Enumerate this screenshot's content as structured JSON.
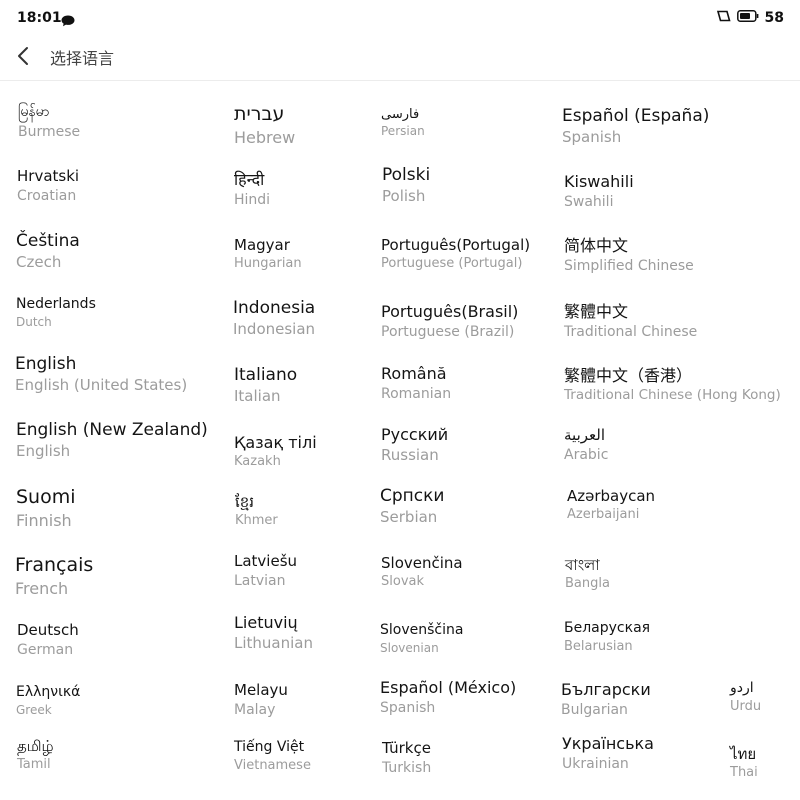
{
  "status_bar": {
    "time": "18:01",
    "battery_level": "58",
    "icons": [
      "chat-bubble-icon",
      "screen-rotation-icon",
      "battery-icon"
    ]
  },
  "header": {
    "title": "选择语言",
    "back_icon": "chevron-left-icon"
  },
  "languages": [
    {
      "native": "မြန်မာ",
      "english": "Burmese"
    },
    {
      "native": "Hrvatski",
      "english": "Croatian"
    },
    {
      "native": "Čeština",
      "english": "Czech"
    },
    {
      "native": "Nederlands",
      "english": "Dutch"
    },
    {
      "native": "English",
      "english": "English (United States)"
    },
    {
      "native": "English (New Zealand)",
      "english": "English"
    },
    {
      "native": "Suomi",
      "english": "Finnish"
    },
    {
      "native": "Français",
      "english": "French"
    },
    {
      "native": "Deutsch",
      "english": "German"
    },
    {
      "native": "Ελληνικά",
      "english": "Greek"
    },
    {
      "native": "தமிழ்",
      "english": "Tamil"
    },
    {
      "native": "עברית",
      "english": "Hebrew"
    },
    {
      "native": "हिन्दी",
      "english": "Hindi"
    },
    {
      "native": "Magyar",
      "english": "Hungarian"
    },
    {
      "native": "Indonesia",
      "english": "Indonesian"
    },
    {
      "native": "Italiano",
      "english": "Italian"
    },
    {
      "native": "Қазақ тілі",
      "english": "Kazakh"
    },
    {
      "native": "ខ្មែរ",
      "english": "Khmer"
    },
    {
      "native": "Latviešu",
      "english": "Latvian"
    },
    {
      "native": "Lietuvių",
      "english": "Lithuanian"
    },
    {
      "native": "Melayu",
      "english": "Malay"
    },
    {
      "native": "Tiếng Việt",
      "english": "Vietnamese"
    },
    {
      "native": "فارسی",
      "english": "Persian"
    },
    {
      "native": "Polski",
      "english": "Polish"
    },
    {
      "native": "Português(Portugal)",
      "english": "Portuguese (Portugal)"
    },
    {
      "native": "Português(Brasil)",
      "english": "Portuguese (Brazil)"
    },
    {
      "native": "Română",
      "english": "Romanian"
    },
    {
      "native": "Русский",
      "english": "Russian"
    },
    {
      "native": "Српски",
      "english": "Serbian"
    },
    {
      "native": "Slovenčina",
      "english": "Slovak"
    },
    {
      "native": "Slovenščina",
      "english": "Slovenian"
    },
    {
      "native": "Español (México)",
      "english": "Spanish"
    },
    {
      "native": "Türkçe",
      "english": "Turkish"
    },
    {
      "native": "Español (España)",
      "english": "Spanish"
    },
    {
      "native": "Kiswahili",
      "english": "Swahili"
    },
    {
      "native": "简体中文",
      "english": "Simplified Chinese"
    },
    {
      "native": "繁體中文",
      "english": "Traditional Chinese"
    },
    {
      "native": "繁體中文（香港）",
      "english": "Traditional Chinese (Hong Kong)"
    },
    {
      "native": "العربية",
      "english": "Arabic"
    },
    {
      "native": "Azərbaycan",
      "english": "Azerbaijani"
    },
    {
      "native": "বাংলা",
      "english": "Bangla"
    },
    {
      "native": "Беларуская",
      "english": "Belarusian"
    },
    {
      "native": "Български",
      "english": "Bulgarian"
    },
    {
      "native": "Українська",
      "english": "Ukrainian"
    },
    {
      "native": "اردو",
      "english": "Urdu"
    },
    {
      "native": "ไทย",
      "english": "Thai"
    }
  ]
}
